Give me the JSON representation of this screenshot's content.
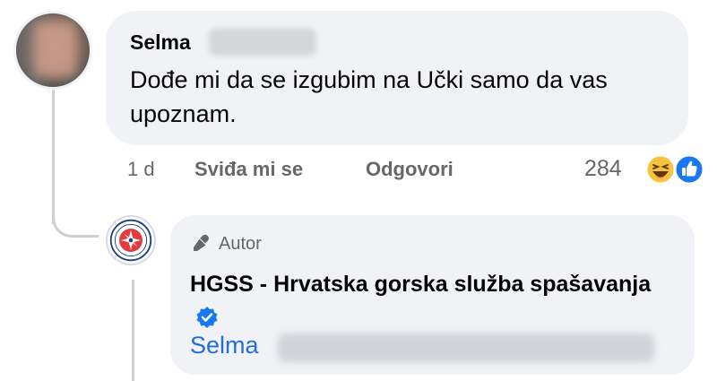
{
  "comment": {
    "author_first_name": "Selma",
    "text": "Dođe mi da se izgubim na Učki samo da vas upoznam.",
    "time": "1 d",
    "like_label": "Sviđa mi se",
    "reply_label": "Odgovori",
    "reaction_count": "284",
    "reaction_icons": [
      "haha-icon",
      "like-icon"
    ]
  },
  "reply": {
    "badge_label": "Autor",
    "author_name": "HGSS - Hrvatska gorska služba spašavanja",
    "mention_first_name": "Selma"
  },
  "colors": {
    "bubble_bg": "#f0f2f5",
    "secondary_text": "#65676b",
    "mention_blue": "#216fdb",
    "verified_blue": "#1877f2"
  }
}
